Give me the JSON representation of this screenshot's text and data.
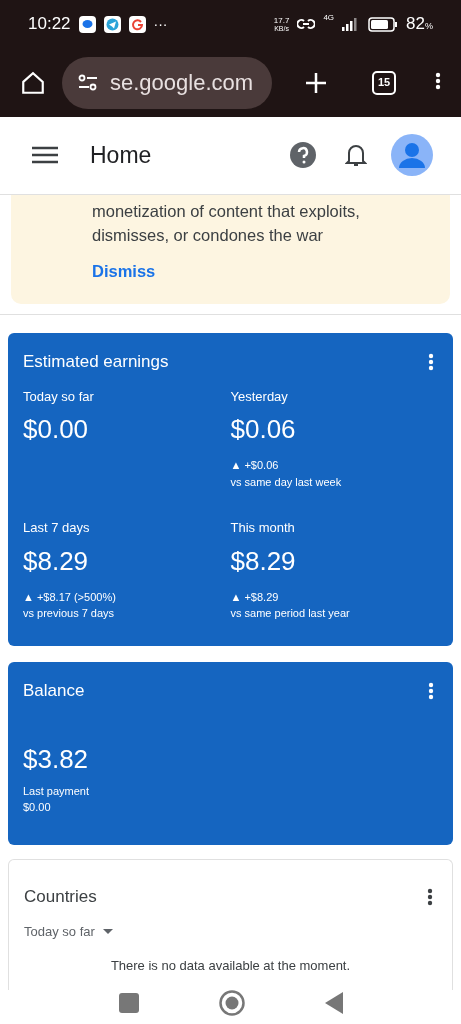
{
  "status_bar": {
    "time": "10:22",
    "more": "···",
    "speed": "17.7",
    "speed_unit": "KB/s",
    "network": "4G",
    "battery": "82",
    "battery_unit": "%"
  },
  "browser": {
    "url": "se.google.com",
    "tab_count": "15"
  },
  "header": {
    "title": "Home"
  },
  "banner": {
    "text": "monetization of content that exploits, dismisses, or condones the war",
    "action": "Dismiss"
  },
  "earnings": {
    "title": "Estimated earnings",
    "metrics": [
      {
        "label": "Today so far",
        "value": "$0.00"
      },
      {
        "label": "Yesterday",
        "value": "$0.06",
        "change": "▲ +$0.06",
        "comparison": "vs same day last week"
      },
      {
        "label": "Last 7 days",
        "value": "$8.29",
        "change": "▲ +$8.17 (>500%)",
        "comparison": "vs previous 7 days"
      },
      {
        "label": "This month",
        "value": "$8.29",
        "change": "▲ +$8.29",
        "comparison": "vs same period last year"
      }
    ]
  },
  "balance": {
    "title": "Balance",
    "value": "$3.82",
    "last_payment_label": "Last payment",
    "last_payment": "$0.00"
  },
  "countries": {
    "title": "Countries",
    "period": "Today so far",
    "empty": "There is no data available at the moment."
  }
}
